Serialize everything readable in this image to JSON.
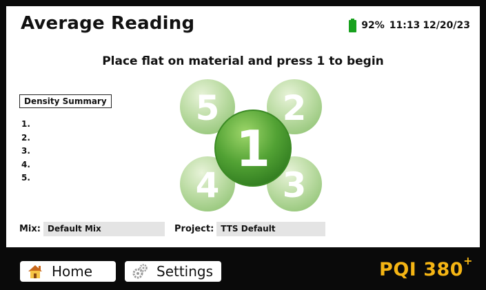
{
  "header": {
    "title": "Average Reading",
    "battery": "92%",
    "time": "11:13",
    "date": "12/20/23"
  },
  "instruction": "Place flat on material and press 1 to begin",
  "summary": {
    "title": "Density Summary",
    "items": [
      "1.",
      "2.",
      "3.",
      "4.",
      "5."
    ]
  },
  "positions": {
    "p1": "1",
    "p2": "2",
    "p3": "3",
    "p4": "4",
    "p5": "5"
  },
  "mix": {
    "label": "Mix:",
    "value": "Default Mix"
  },
  "project": {
    "label": "Project:",
    "value": "TTS Default"
  },
  "nav": {
    "home": "Home",
    "settings": "Settings"
  },
  "brand": {
    "name": "PQI 380",
    "superscript": "+"
  },
  "colors": {
    "accent_green": "#4a9a2a",
    "battery_green": "#18a11e",
    "brand_yellow": "#f5b514"
  }
}
